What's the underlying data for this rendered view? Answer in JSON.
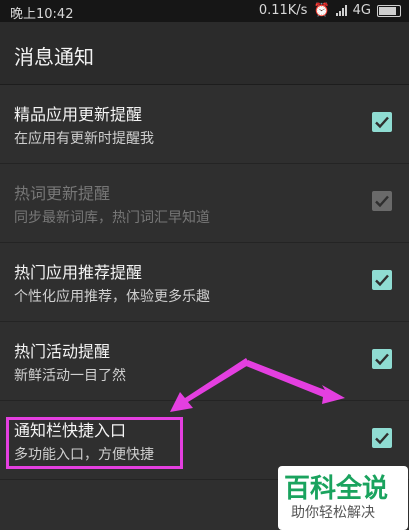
{
  "status_bar": {
    "time": "晚上10:42",
    "net_speed": "0.11K/s",
    "network": "4G",
    "icons": [
      "alarm-icon",
      "signal-icon",
      "battery-icon"
    ]
  },
  "header": {
    "title": "消息通知"
  },
  "settings": [
    {
      "title": "精品应用更新提醒",
      "subtitle": "在应用有更新时提醒我",
      "checked": true,
      "enabled": true
    },
    {
      "title": "热词更新提醒",
      "subtitle": "同步最新词库，热门词汇早知道",
      "checked": true,
      "enabled": false
    },
    {
      "title": "热门应用推荐提醒",
      "subtitle": "个性化应用推荐，体验更多乐趣",
      "checked": true,
      "enabled": true
    },
    {
      "title": "热门活动提醒",
      "subtitle": "新鲜活动一目了然",
      "checked": true,
      "enabled": true
    },
    {
      "title": "通知栏快捷入口",
      "subtitle": "多功能入口，方便快捷",
      "checked": true,
      "enabled": true
    }
  ],
  "watermark": {
    "name": "百科全说",
    "tagline": "助你轻松解决"
  },
  "colors": {
    "checkbox_active": "#8fdcd2",
    "annotation": "#e43fe0",
    "watermark_green": "#1aa35e"
  }
}
